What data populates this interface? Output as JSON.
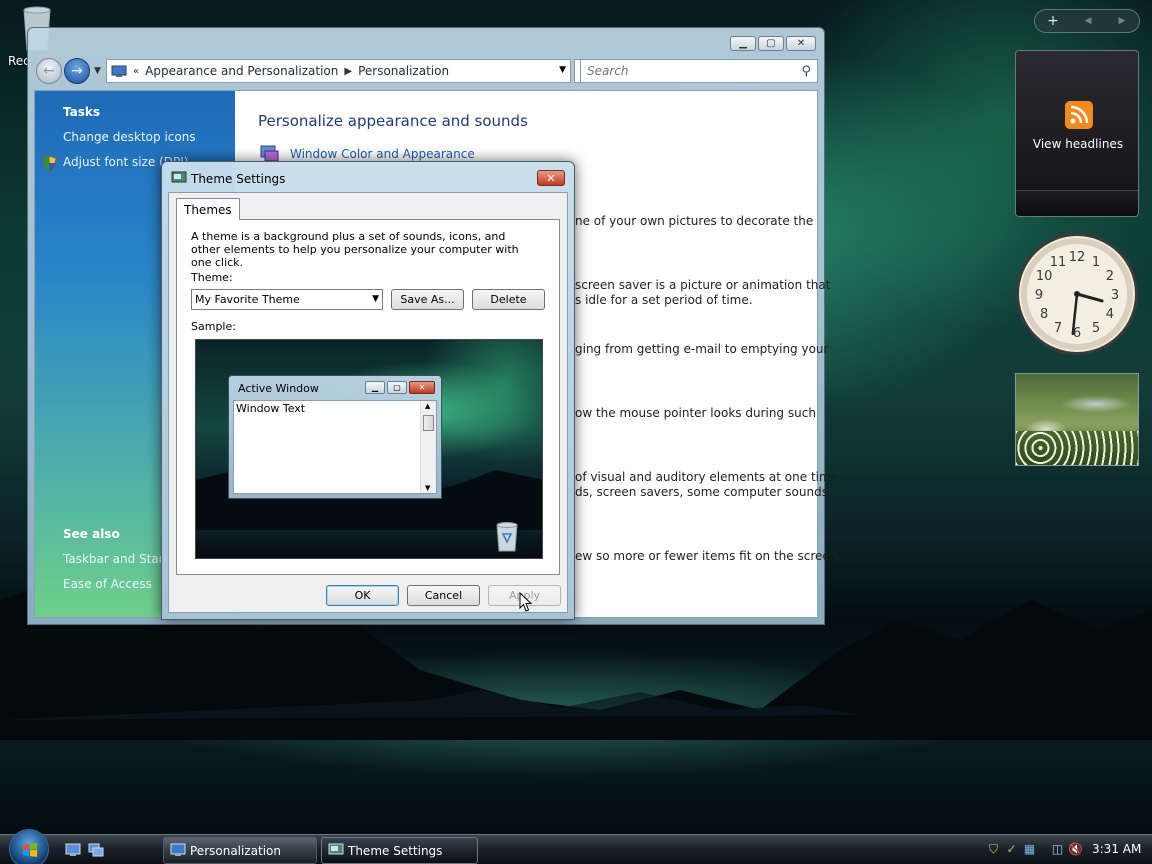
{
  "desktop": {
    "recycle_bin_label": "Rec"
  },
  "explorer": {
    "breadcrumb_prefix": "«",
    "breadcrumb": [
      "Appearance and Personalization",
      "Personalization"
    ],
    "search_placeholder": "Search",
    "tasks_heading": "Tasks",
    "tasks": [
      "Change desktop icons",
      "Adjust font size (DPI)"
    ],
    "see_also_heading": "See also",
    "see_also": [
      "Taskbar and Start M",
      "Ease of Access"
    ],
    "main_title": "Personalize appearance and sounds",
    "main_link": "Window Color and Appearance",
    "descriptions": [
      [
        "ne of your own pictures to decorate the"
      ],
      [
        "screen saver is a picture or animation that",
        "s idle for a set period of time."
      ],
      [
        "ging from getting e-mail to emptying your"
      ],
      [
        "ow the mouse pointer looks during such"
      ],
      [
        "of visual and auditory elements at one time",
        "ds, screen savers, some computer sounds,"
      ],
      [
        "ew so more or fewer items fit on the screen."
      ]
    ]
  },
  "dialog": {
    "title": "Theme Settings",
    "close_glyph": "✕",
    "tab_label": "Themes",
    "intro": "A theme is a background plus a set of sounds, icons, and other elements to help you personalize your computer with one click.",
    "theme_label": "Theme:",
    "theme_value": "My Favorite Theme",
    "save_as_label": "Save As...",
    "delete_label": "Delete",
    "sample_label": "Sample:",
    "sample_window_title": "Active Window",
    "sample_window_text": "Window Text",
    "ok_label": "OK",
    "cancel_label": "Cancel",
    "apply_label": "Apply"
  },
  "gadgets": {
    "add_glyph": "+",
    "feed_text": "View headlines",
    "clock_numbers": [
      "12",
      "1",
      "2",
      "3",
      "4",
      "5",
      "6",
      "7",
      "8",
      "9",
      "10",
      "11"
    ],
    "clock_time": {
      "hour": 3,
      "minute": 31
    }
  },
  "taskbar": {
    "buttons": [
      "Personalization",
      "Theme Settings"
    ],
    "clock": "3:31 AM"
  }
}
